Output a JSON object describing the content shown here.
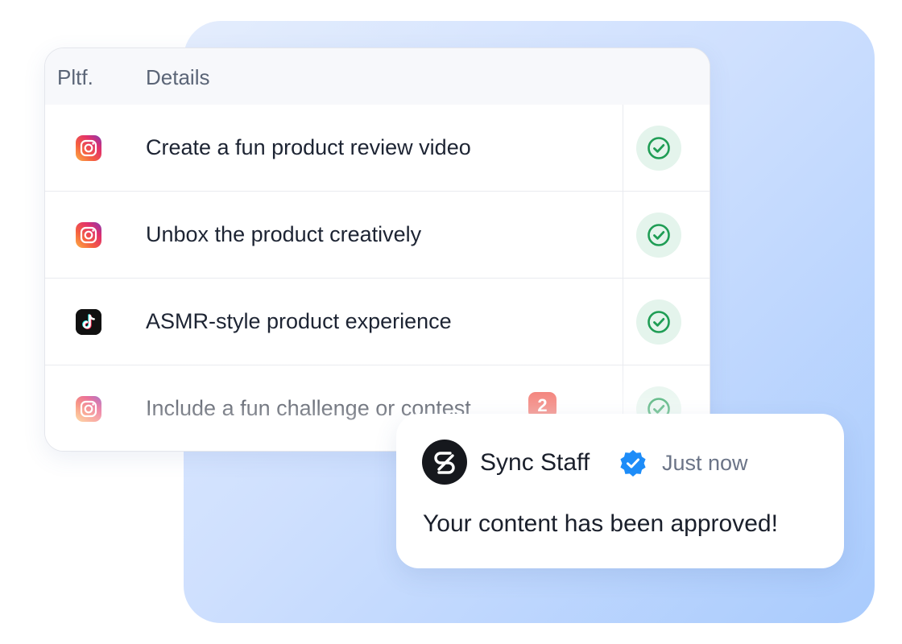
{
  "table": {
    "headers": {
      "platform": "Pltf.",
      "details": "Details"
    },
    "rows": [
      {
        "platform": "instagram",
        "details": "Create a fun product review video",
        "status": "approved"
      },
      {
        "platform": "instagram",
        "details": "Unbox the product creatively",
        "status": "approved"
      },
      {
        "platform": "tiktok",
        "details": "ASMR-style product experience",
        "status": "approved"
      },
      {
        "platform": "instagram",
        "details": "Include a fun challenge or contest",
        "status": "approved",
        "badge": "2"
      }
    ]
  },
  "notification": {
    "sender": "Sync Staff",
    "verified": true,
    "time": "Just now",
    "message": "Your content has been approved!"
  },
  "icons": {
    "instagram": "instagram-icon",
    "tiktok": "tiktok-icon",
    "check": "check-circle-icon",
    "verified": "verified-badge-icon",
    "avatar": "sync-logo-icon"
  },
  "colors": {
    "instagram_gradient": [
      "#fcaf45",
      "#f56040",
      "#e1306c",
      "#833ab4"
    ],
    "tiktok_bg": "#111111",
    "check_green": "#1f9d55",
    "check_bg": "#e4f4ec",
    "badge_red": "#ef5a50",
    "verified_blue": "#1d8cf8",
    "panel_gradient": [
      "#e4edfd",
      "#a9cbfd"
    ]
  }
}
